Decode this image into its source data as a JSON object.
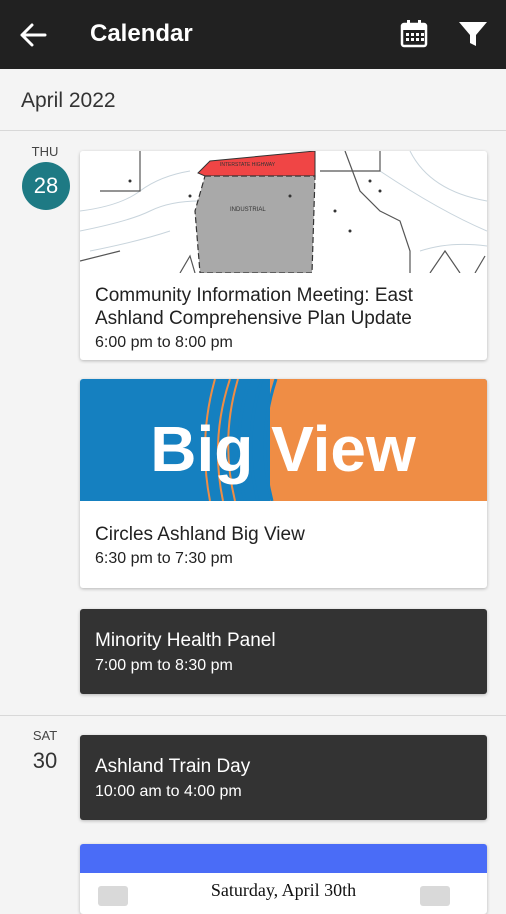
{
  "appbar": {
    "title": "Calendar",
    "back_icon": "arrow-left-icon",
    "calendar_icon": "calendar-icon",
    "filter_icon": "filter-icon"
  },
  "month": "April 2022",
  "days": [
    {
      "dow": "THU",
      "day": "28",
      "events": [
        {
          "title": "Community Information Meeting: East Ashland Comprehensive Plan Update",
          "time": "6:00 pm to 8:00 pm"
        },
        {
          "title": "Circles Ashland Big View",
          "time": "6:30 pm to 7:30 pm",
          "banner_text": "Big View"
        },
        {
          "title": "Minority Health Panel",
          "time": "7:00 pm to 8:30 pm"
        }
      ]
    },
    {
      "dow": "SAT",
      "day": "30",
      "events": [
        {
          "title": "Ashland Train Day",
          "time": "10:00 am to 4:00 pm"
        },
        {
          "banner_text": "Saturday, April 30th"
        }
      ]
    }
  ],
  "map_labels": {
    "zone": "INDUSTRIAL",
    "top": "INTERSTATE HIGHWAY"
  },
  "colors": {
    "appbar": "#212121",
    "accent": "#1e7a84",
    "bigview_blue": "#1580c0",
    "bigview_orange": "#ef8d45",
    "banner_blue": "#4a6cf7"
  }
}
